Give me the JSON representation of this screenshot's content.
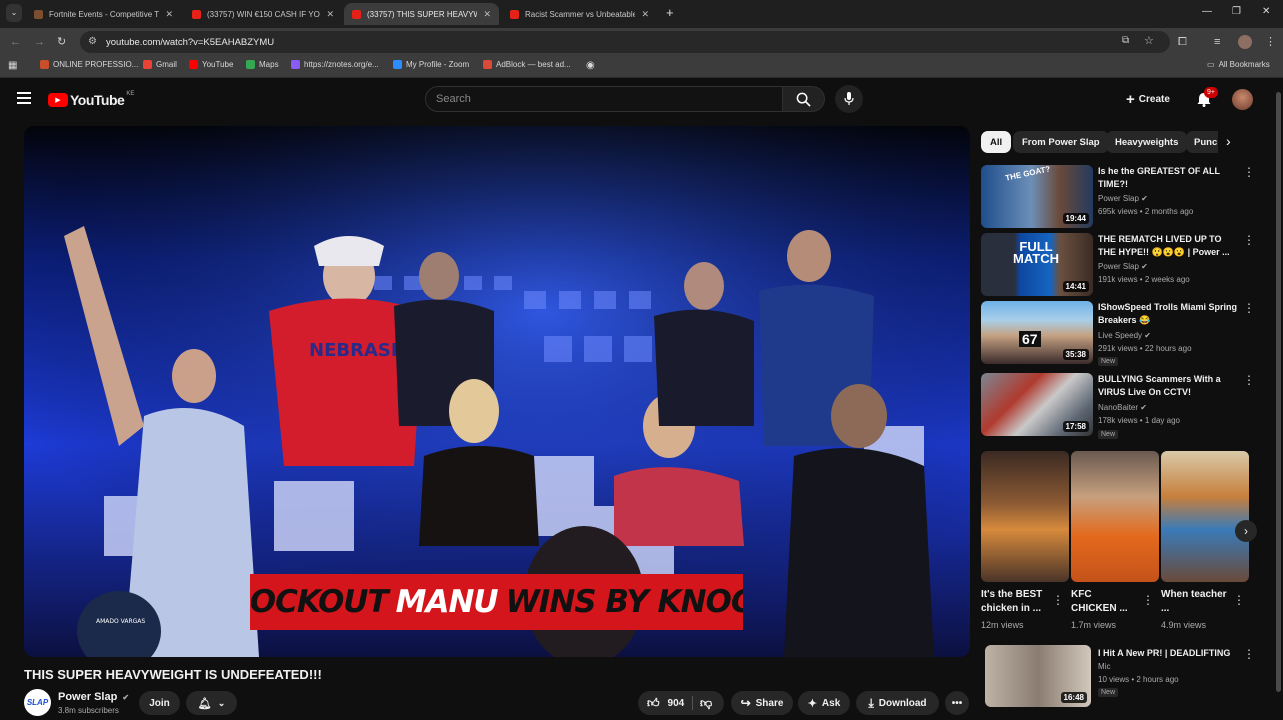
{
  "browser": {
    "tabs": [
      {
        "title": "Fortnite Events - Competitive T",
        "color": "#7c4d2e"
      },
      {
        "title": "(33757) WIN €150 CASH IF YOU",
        "color": "#e62117"
      },
      {
        "title": "(33757) THIS SUPER HEAVYWEIG",
        "color": "#e62117"
      },
      {
        "title": "Racist Scammer vs Unbeatable",
        "color": "#e62117"
      }
    ],
    "url": "youtube.com/watch?v=K5EAHABZYMU",
    "bookmarks": [
      {
        "label": "ONLINE PROFESSIO...",
        "color": "#c94f2b"
      },
      {
        "label": "Gmail",
        "color": "#ea4335"
      },
      {
        "label": "YouTube",
        "color": "#ff0000"
      },
      {
        "label": "Maps",
        "color": "#34a853"
      },
      {
        "label": "https://znotes.org/e...",
        "color": "#8a5cf6"
      },
      {
        "label": "My Profile - Zoom",
        "color": "#2d8cff"
      },
      {
        "label": "AdBlock — best ad...",
        "color": "#d94a38"
      }
    ],
    "all_bookmarks": "All Bookmarks"
  },
  "youtube": {
    "logo": "YouTube",
    "country": "KE",
    "search_placeholder": "Search",
    "create_label": "Create",
    "notif_count": "9+"
  },
  "video": {
    "title": "THIS SUPER HEAVYWEIGHT IS UNDEFEATED!!!",
    "banner_left": "BY KNOCKOUT",
    "banner_name": "MANU",
    "banner_right": "WINS BY KNOCKOUT",
    "seat_sign": "AMADO VARGAS",
    "shirt_text": "NEBRASKA",
    "channel": "Power Slap",
    "subscribers": "3.8m subscribers",
    "join_label": "Join",
    "likes": "904",
    "share_label": "Share",
    "ask_label": "Ask",
    "download_label": "Download"
  },
  "chips": [
    "All",
    "From Power Slap",
    "Heavyweights",
    "Punc"
  ],
  "recommendations": [
    {
      "title": "Is he the GREATEST OF ALL TIME?!",
      "channel": "Power Slap",
      "meta": "695k views • 2 months ago",
      "duration": "19:44",
      "new": "",
      "thumb_text": "THE GOAT?"
    },
    {
      "title": "THE REMATCH LIVED UP TO THE HYPE!! 😲😮😮 | Power ...",
      "channel": "Power Slap",
      "meta": "191k views • 2 weeks ago",
      "duration": "14:41",
      "new": "",
      "thumb_text": "FULL MATCH"
    },
    {
      "title": "IShowSpeed Trolls Miami Spring Breakers 😂",
      "channel": "Live Speedy",
      "meta": "291k views • 22 hours ago",
      "duration": "35:38",
      "new": "New",
      "thumb_text": "67"
    },
    {
      "title": "BULLYING Scammers With a VIRUS Live On CCTV!",
      "channel": "NanoBaiter",
      "meta": "178k views • 1 day ago",
      "duration": "17:58",
      "new": "New",
      "thumb_text": ""
    }
  ],
  "shorts": [
    {
      "title": "It's the BEST chicken in ...",
      "views": "12m views"
    },
    {
      "title": "KFC CHICKEN ...",
      "views": "1.7m views"
    },
    {
      "title": "When teacher ...",
      "views": "4.9m views"
    }
  ],
  "bottom_rec": {
    "title": "I Hit A New PR! | DEADLIFTING",
    "channel": "Mic",
    "meta": "10 views • 2 hours ago",
    "duration": "16:48",
    "new": "New"
  }
}
